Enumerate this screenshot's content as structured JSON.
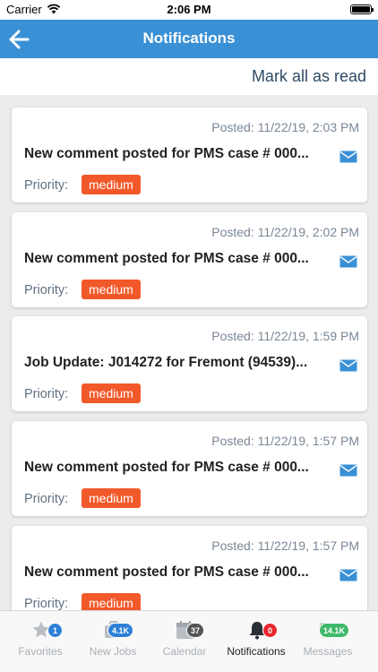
{
  "status_bar": {
    "carrier": "Carrier",
    "time": "2:06 PM"
  },
  "header": {
    "title": "Notifications"
  },
  "actions": {
    "mark_all_read": "Mark all as read"
  },
  "priority_label": "Priority:",
  "notifications": [
    {
      "posted": "Posted: 11/22/19, 2:03 PM",
      "subject": "New comment posted for PMS case # 000...",
      "priority": "medium"
    },
    {
      "posted": "Posted: 11/22/19, 2:02 PM",
      "subject": "New comment posted for PMS case # 000...",
      "priority": "medium"
    },
    {
      "posted": "Posted: 11/22/19, 1:59 PM",
      "subject": "Job Update: J014272 for Fremont (94539)...",
      "priority": "medium"
    },
    {
      "posted": "Posted: 11/22/19, 1:57 PM",
      "subject": "New comment posted for PMS case # 000...",
      "priority": "medium"
    },
    {
      "posted": "Posted: 11/22/19, 1:57 PM",
      "subject": "New comment posted for PMS case # 000...",
      "priority": "medium"
    }
  ],
  "tabs": [
    {
      "label": "Favorites",
      "badge": "1",
      "badge_color": "#2f80d8",
      "icon": "star-icon"
    },
    {
      "label": "New Jobs",
      "badge": "4.1K",
      "badge_color": "#2f80d8",
      "icon": "briefcase-icon"
    },
    {
      "label": "Calendar",
      "badge": "37",
      "badge_color": "#555555",
      "icon": "calendar-icon"
    },
    {
      "label": "Notifications",
      "badge": "0",
      "badge_color": "#e8262b",
      "icon": "bell-icon",
      "active": true
    },
    {
      "label": "Messages",
      "badge": "14.1K",
      "badge_color": "#3fb96a",
      "icon": "chat-icon"
    }
  ],
  "colors": {
    "nav_bar": "#3a90d5",
    "priority_medium": "#f2592a"
  }
}
